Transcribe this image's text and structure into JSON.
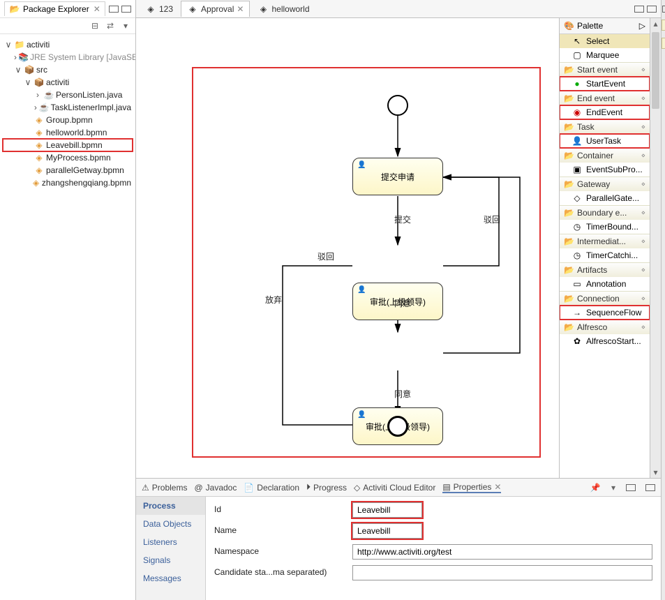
{
  "package_explorer": {
    "title": "Package Explorer",
    "toolbar": {
      "collapse": "⊟",
      "link": "⇄",
      "menu": "▾"
    },
    "items": [
      {
        "icon": "activiti",
        "label": "activiti",
        "exp": "∨",
        "indent": 0
      },
      {
        "icon": "jar",
        "label": "JRE System Library [JavaSE",
        "exp": "›",
        "indent": 1,
        "gray": true
      },
      {
        "icon": "src",
        "label": "src",
        "exp": "∨",
        "indent": 1
      },
      {
        "icon": "pkg",
        "label": "activiti",
        "exp": "∨",
        "indent": 2
      },
      {
        "icon": "java",
        "label": "PersonListen.java",
        "exp": "›",
        "indent": 3
      },
      {
        "icon": "java",
        "label": "TaskListenerImpl.java",
        "exp": "›",
        "indent": 3
      },
      {
        "icon": "bpmn",
        "label": "Group.bpmn",
        "exp": "",
        "indent": 2
      },
      {
        "icon": "bpmn",
        "label": "helloworld.bpmn",
        "exp": "",
        "indent": 2
      },
      {
        "icon": "bpmn",
        "label": "Leavebill.bpmn",
        "exp": "",
        "indent": 2,
        "hl": true
      },
      {
        "icon": "bpmn",
        "label": "MyProcess.bpmn",
        "exp": "",
        "indent": 2
      },
      {
        "icon": "bpmn",
        "label": "parallelGetway.bpmn",
        "exp": "",
        "indent": 2
      },
      {
        "icon": "bpmn",
        "label": "zhangshengqiang.bpmn",
        "exp": "",
        "indent": 2
      }
    ]
  },
  "editor_tabs": [
    {
      "label": "123",
      "active": false
    },
    {
      "label": "Approval",
      "active": true
    },
    {
      "label": "helloworld",
      "active": false
    }
  ],
  "diagram": {
    "task1": "提交申请",
    "task2": "审批(上级领导)",
    "task3": "审批(上上级领导)",
    "label_submit": "提交",
    "label_reject_upper": "驳回",
    "label_reject_mid": "驳回",
    "label_agree1": "同意",
    "label_agree2": "同意",
    "label_abandon": "放弃"
  },
  "palette": {
    "title": "Palette",
    "select": "Select",
    "marquee": "Marquee",
    "groups": [
      {
        "label": "Start event",
        "items": [
          {
            "label": "StartEvent",
            "icon": "start",
            "hl": true
          }
        ]
      },
      {
        "label": "End event",
        "items": [
          {
            "label": "EndEvent",
            "icon": "end",
            "hl": true
          }
        ]
      },
      {
        "label": "Task",
        "items": [
          {
            "label": "UserTask",
            "icon": "user",
            "hl": true
          }
        ]
      },
      {
        "label": "Container",
        "items": [
          {
            "label": "EventSubPro...",
            "icon": "sub"
          }
        ]
      },
      {
        "label": "Gateway",
        "items": [
          {
            "label": "ParallelGate...",
            "icon": "gw"
          }
        ]
      },
      {
        "label": "Boundary e...",
        "items": [
          {
            "label": "TimerBound...",
            "icon": "timer"
          }
        ]
      },
      {
        "label": "Intermediat...",
        "items": [
          {
            "label": "TimerCatchi...",
            "icon": "timer"
          }
        ]
      },
      {
        "label": "Artifacts",
        "items": [
          {
            "label": "Annotation",
            "icon": "anno"
          }
        ]
      },
      {
        "label": "Connection",
        "items": [
          {
            "label": "SequenceFlow",
            "icon": "seq",
            "hl": true
          }
        ]
      },
      {
        "label": "Alfresco",
        "items": [
          {
            "label": "AlfrescoStart...",
            "icon": "alf"
          }
        ]
      }
    ]
  },
  "bottom_tabs": [
    {
      "label": "Problems",
      "icon": "⚠"
    },
    {
      "label": "Javadoc",
      "icon": "@"
    },
    {
      "label": "Declaration",
      "icon": "📄"
    },
    {
      "label": "Progress",
      "icon": "⏵"
    },
    {
      "label": "Activiti Cloud Editor",
      "icon": "◇"
    },
    {
      "label": "Properties",
      "icon": "▤",
      "active": true
    }
  ],
  "prop_sidebar": [
    {
      "label": "Process",
      "active": true
    },
    {
      "label": "Data Objects"
    },
    {
      "label": "Listeners"
    },
    {
      "label": "Signals"
    },
    {
      "label": "Messages"
    }
  ],
  "properties": {
    "id_label": "Id",
    "id_value": "Leavebill",
    "name_label": "Name",
    "name_value": "Leavebill",
    "ns_label": "Namespace",
    "ns_value": "http://www.activiti.org/test",
    "cand_label": "Candidate sta...ma separated)",
    "cand_value": ""
  }
}
